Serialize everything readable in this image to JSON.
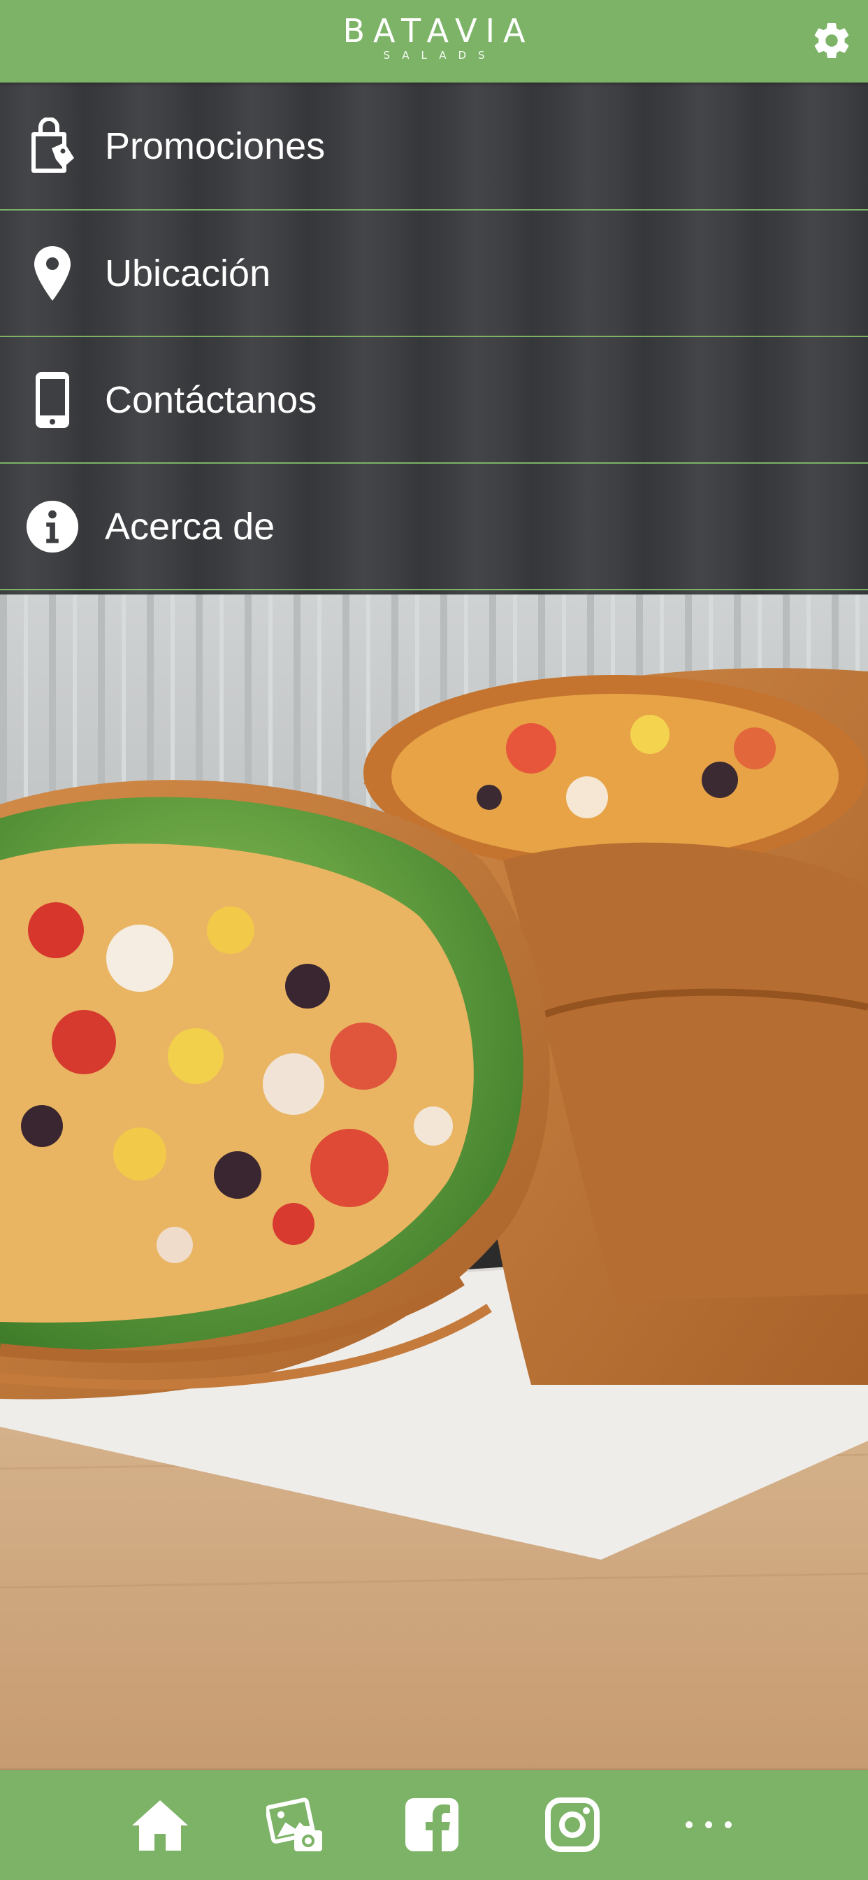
{
  "header": {
    "logo_main": "BATAVIA",
    "logo_sub": "SALADS",
    "settings_icon": "gear-icon"
  },
  "menu": {
    "items": [
      {
        "label": "Promociones",
        "icon": "shopping-bag-tag-icon"
      },
      {
        "label": "Ubicación",
        "icon": "map-pin-icon"
      },
      {
        "label": "Contáctanos",
        "icon": "smartphone-icon"
      },
      {
        "label": "Acerca de",
        "icon": "info-icon"
      }
    ]
  },
  "tabbar": {
    "items": [
      {
        "icon": "home-icon"
      },
      {
        "icon": "photo-gallery-icon"
      },
      {
        "icon": "facebook-icon"
      },
      {
        "icon": "instagram-icon"
      },
      {
        "icon": "more-icon"
      }
    ]
  },
  "colors": {
    "brand_green": "#7cb366",
    "menu_bg": "#3e3f42",
    "text": "#ffffff"
  }
}
